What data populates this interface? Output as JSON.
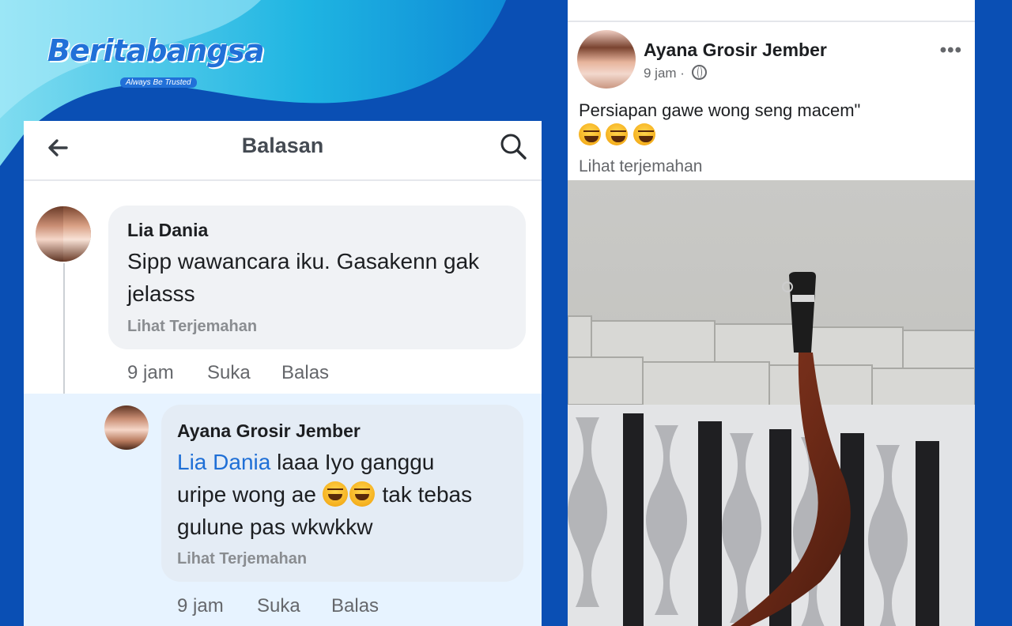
{
  "logo": {
    "name": "Beritabangsa",
    "tagline": "Always Be Trusted"
  },
  "reply_screen": {
    "title": "Balasan",
    "comment": {
      "author": "Lia Dania",
      "text": "Sipp wawancara iku. Gasakenn gak jelasss",
      "translate": "Lihat Terjemahan",
      "time": "9 jam",
      "like": "Suka",
      "reply": "Balas"
    },
    "reply": {
      "author": "Ayana Grosir Jember",
      "mention": "Lia Dania",
      "text_line1": "laaa Iyo ganggu",
      "text_line2a": "uripe wong ae",
      "text_line2b": "tak tebas",
      "text_line3": "gulune pas wkwkkw",
      "translate": "Lihat Terjemahan",
      "time": "9 jam",
      "like": "Suka",
      "reply": "Balas"
    }
  },
  "post": {
    "author": "Ayana Grosir Jember",
    "time": "9 jam",
    "text": "Persiapan gawe wong seng macem\"",
    "emojis": [
      "laughing-rolling-emoji",
      "laughing-rolling-emoji",
      "laughing-rolling-emoji"
    ],
    "translate": "Lihat terjemahan"
  },
  "colors": {
    "brand": "#0a4fb4",
    "mention": "#1f6fd6",
    "bubble": "#f0f2f5",
    "reply_bg": "#e7f3ff"
  }
}
